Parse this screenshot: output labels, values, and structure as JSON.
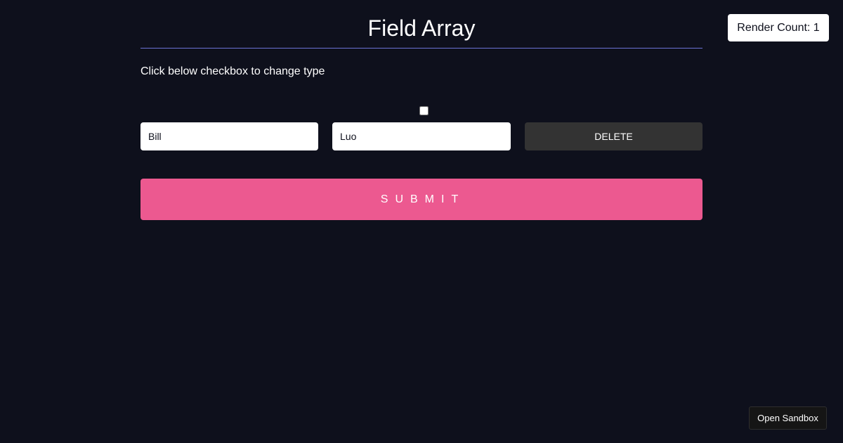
{
  "render_count": {
    "label": "Render Count: 1"
  },
  "header": {
    "title": "Field Array"
  },
  "form": {
    "instructions": "Click below checkbox to change type",
    "type_checkbox_checked": false,
    "fields": [
      {
        "first_name": "Bill",
        "last_name": "Luo",
        "delete_label": "DELETE"
      }
    ],
    "submit_label": "SUBMIT"
  },
  "sandbox": {
    "open_label": "Open Sandbox"
  },
  "colors": {
    "background": "#0e101c",
    "accent": "#ec5990",
    "divider": "#6b73d6",
    "delete_button": "#333333"
  }
}
